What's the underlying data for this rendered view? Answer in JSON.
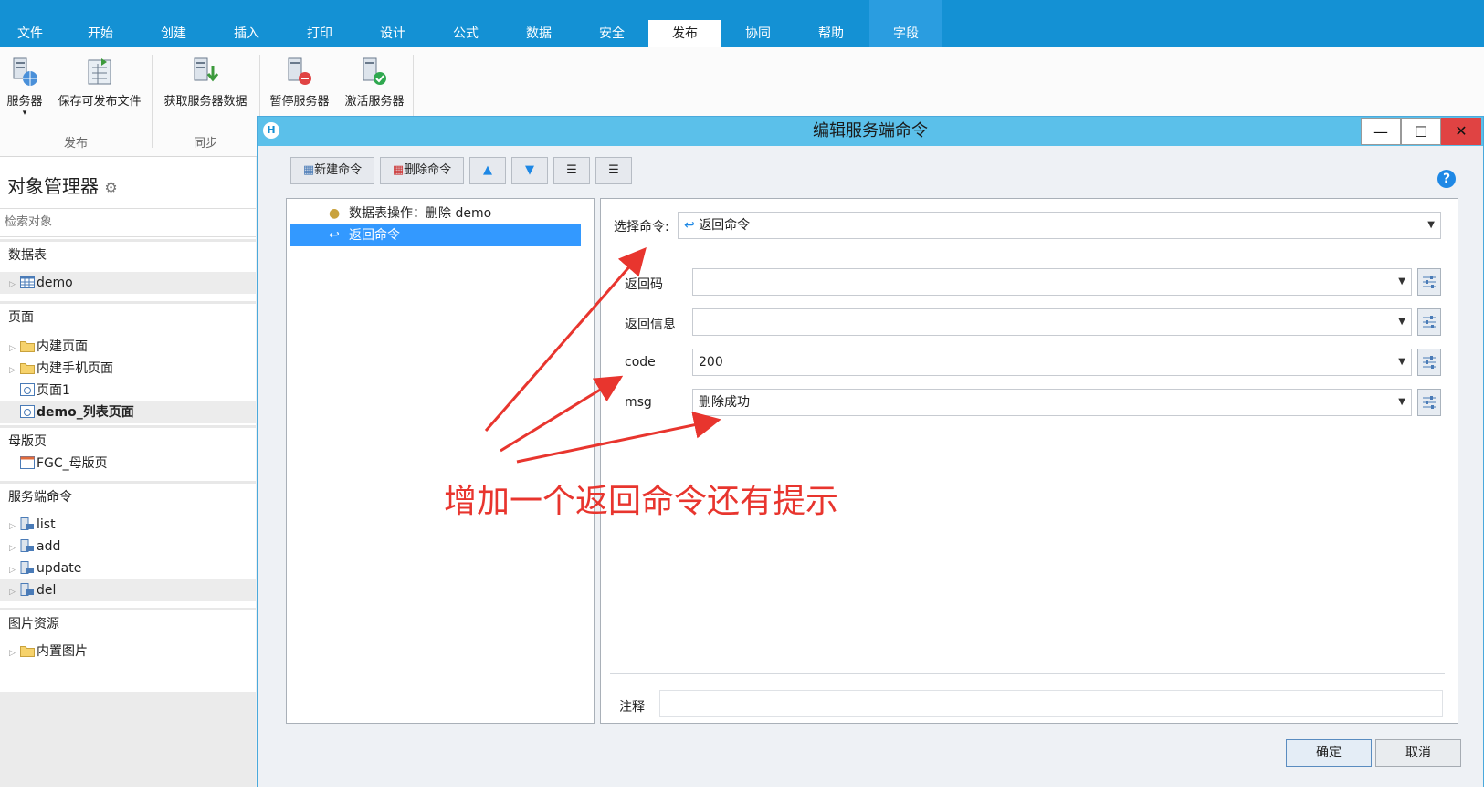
{
  "ribbon": {
    "tabs": [
      "文件",
      "开始",
      "创建",
      "插入",
      "打印",
      "设计",
      "公式",
      "数据",
      "安全",
      "发布",
      "协同",
      "帮助",
      "字段"
    ],
    "active_tab": "发布",
    "buttons": {
      "server": "服务器",
      "save_publish": "保存可发布文件",
      "fetch_server_data": "获取服务器数据",
      "pause_server": "暂停服务器",
      "activate_server": "激活服务器"
    },
    "groups": {
      "publish": "发布",
      "sync": "同步"
    }
  },
  "object_manager": {
    "title": "对象管理器",
    "search_placeholder": "检索对象",
    "sections": {
      "tables": "数据表",
      "pages": "页面",
      "masters": "母版页",
      "server_commands": "服务端命令",
      "images": "图片资源"
    },
    "tables": [
      "demo"
    ],
    "pages": [
      "内建页面",
      "内建手机页面",
      "页面1",
      "demo_列表页面"
    ],
    "masters": [
      "FGC_母版页"
    ],
    "commands": [
      "list",
      "add",
      "update",
      "del"
    ],
    "images": [
      "内置图片"
    ]
  },
  "dialog": {
    "title": "编辑服务端命令",
    "toolbar": {
      "new_cmd": "新建命令",
      "delete_cmd": "删除命令"
    },
    "commands": [
      "数据表操作：删除 demo",
      "返回命令"
    ],
    "selected_command": "返回命令",
    "select_label": "选择命令:",
    "select_value": "返回命令",
    "params": [
      {
        "label": "返回码",
        "value": ""
      },
      {
        "label": "返回信息",
        "value": ""
      },
      {
        "label": "code",
        "value": "200"
      },
      {
        "label": "msg",
        "value": "删除成功"
      }
    ],
    "comment_label": "注释",
    "ok": "确定",
    "cancel": "取消"
  },
  "annotation": "增加一个返回命令还有提示",
  "colors": {
    "accent": "#1491d4",
    "selection": "#3399ff",
    "annotation": "#e8352e",
    "close": "#e04343"
  }
}
